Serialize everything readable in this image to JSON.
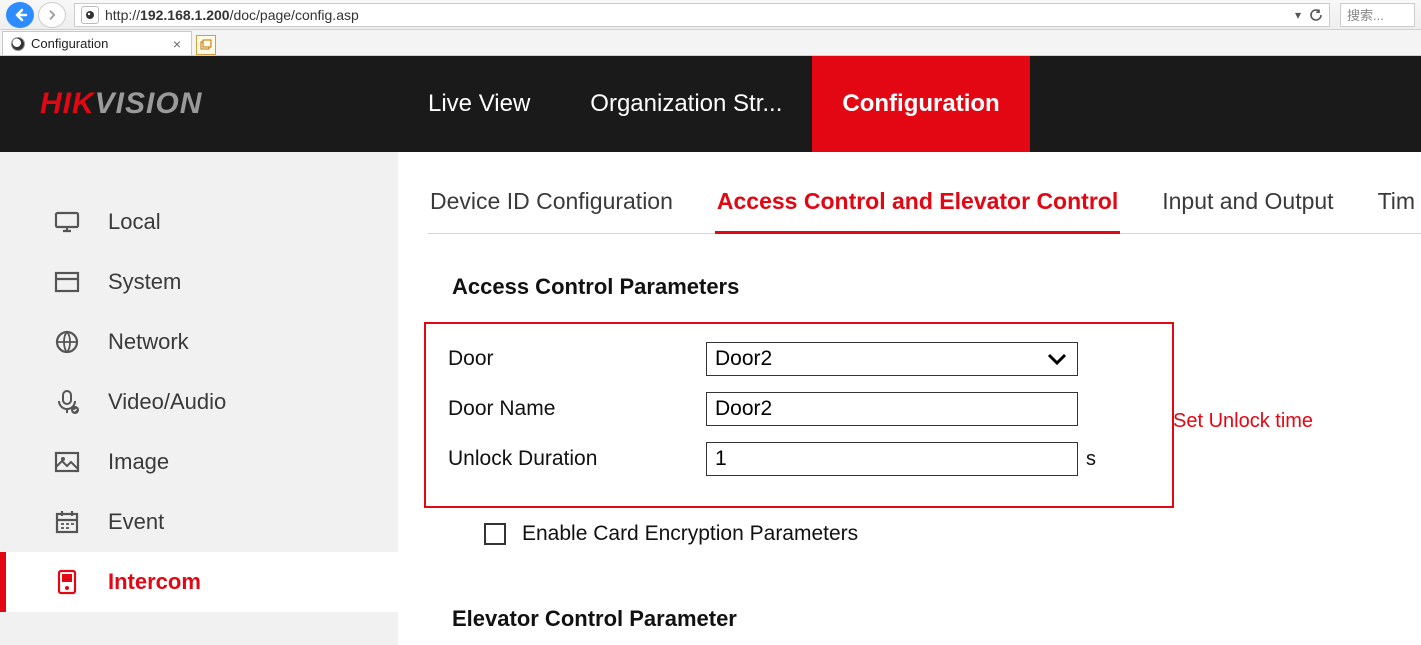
{
  "browser": {
    "url_host": "192.168.1.200",
    "url_prefix": "http://",
    "url_path": "/doc/page/config.asp",
    "tab_title": "Configuration",
    "search_placeholder": "搜索..."
  },
  "logo": {
    "part1": "HIK",
    "part2": "VISION"
  },
  "top_nav": {
    "items": [
      "Live View",
      "Organization Str...",
      "Configuration"
    ],
    "active_index": 2
  },
  "sidebar": {
    "items": [
      {
        "label": "Local",
        "icon": "monitor-icon"
      },
      {
        "label": "System",
        "icon": "window-icon"
      },
      {
        "label": "Network",
        "icon": "globe-icon"
      },
      {
        "label": "Video/Audio",
        "icon": "mic-icon"
      },
      {
        "label": "Image",
        "icon": "image-icon"
      },
      {
        "label": "Event",
        "icon": "calendar-icon"
      },
      {
        "label": "Intercom",
        "icon": "intercom-icon"
      }
    ],
    "active_index": 6
  },
  "sub_tabs": {
    "items": [
      "Device ID Configuration",
      "Access Control and Elevator Control",
      "Input and Output",
      "Tim"
    ],
    "active_index": 1
  },
  "section1_title": "Access Control Parameters",
  "form": {
    "door_label": "Door",
    "door_value": "Door2",
    "door_name_label": "Door Name",
    "door_name_value": "Door2",
    "unlock_label": "Unlock Duration",
    "unlock_value": "1",
    "unlock_unit": "s",
    "enable_encrypt_label": "Enable Card Encryption Parameters",
    "enable_encrypt_checked": false
  },
  "annotation": "Set Unlock time",
  "section2_title": "Elevator Control Parameter"
}
